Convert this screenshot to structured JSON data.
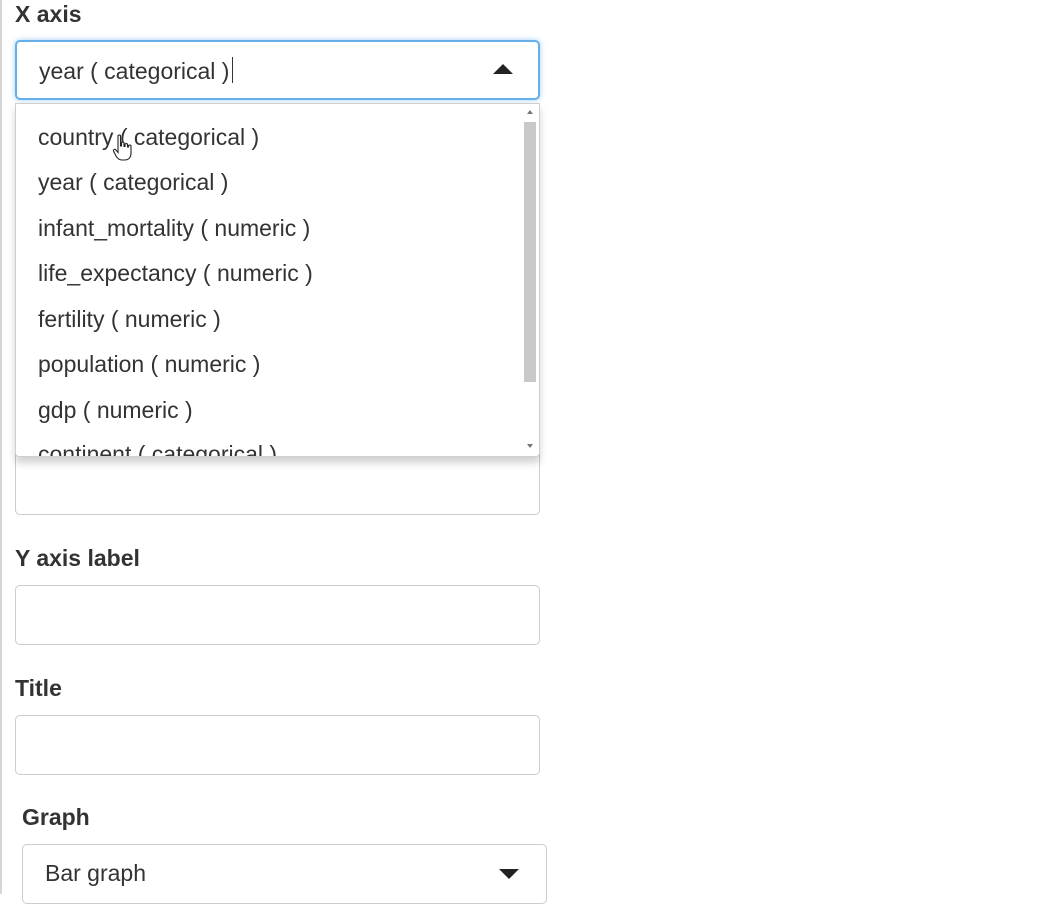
{
  "x_axis": {
    "label": "X axis",
    "selected": "year ( categorical )",
    "options": [
      "country ( categorical )",
      "year ( categorical )",
      "infant_mortality ( numeric )",
      "life_expectancy ( numeric )",
      "fertility ( numeric )",
      "population ( numeric )",
      "gdp ( numeric )",
      "continent ( categorical )"
    ]
  },
  "x_axis_label_input": {
    "value": ""
  },
  "y_axis_label": {
    "label": "Y axis label",
    "value": ""
  },
  "title_field": {
    "label": "Title",
    "value": ""
  },
  "graph": {
    "label": "Graph",
    "selected": "Bar graph"
  },
  "colors": {
    "focus": "#66afe9",
    "border": "#cccccc",
    "text": "#333333"
  }
}
